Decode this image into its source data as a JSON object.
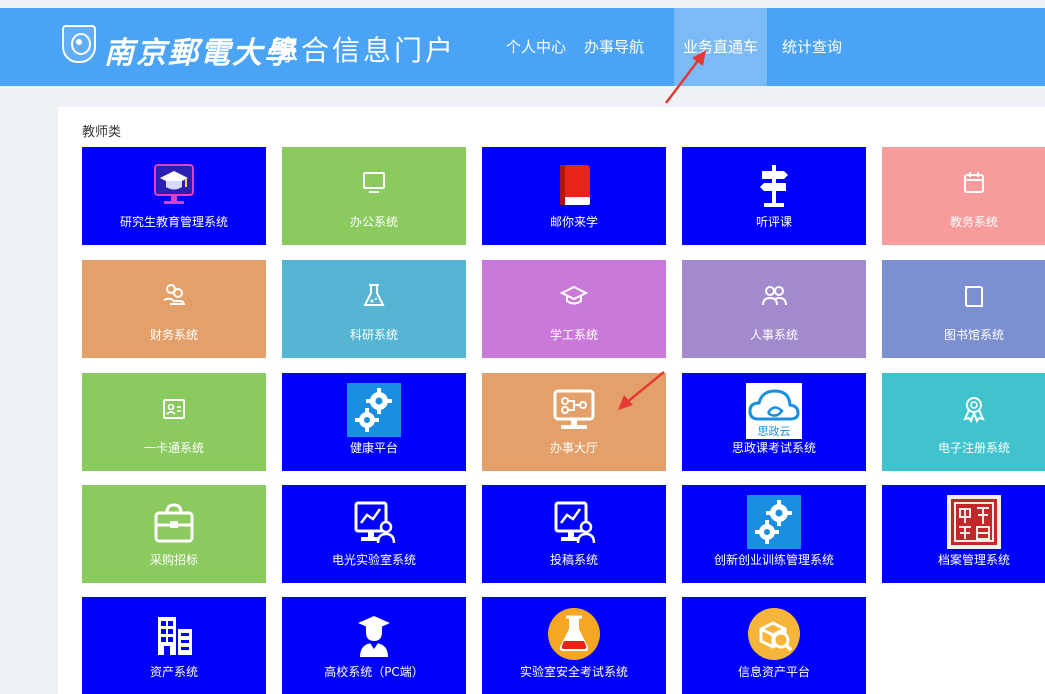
{
  "header": {
    "school_name": "南京郵電大學",
    "portal_name": "综合信息门户",
    "nav": [
      {
        "label": "个人中心",
        "active": false
      },
      {
        "label": "办事导航",
        "active": false
      },
      {
        "label": "业务直通车",
        "active": true
      },
      {
        "label": "统计查询",
        "active": false
      }
    ]
  },
  "section": {
    "title": "教师类"
  },
  "tiles": [
    {
      "label": "研究生教育管理系统",
      "icon": "graduation-monitor-icon",
      "color": "#0000fd"
    },
    {
      "label": "办公系统",
      "icon": "monitor-icon",
      "color": "#8bca5e"
    },
    {
      "label": "邮你来学",
      "icon": "red-book-icon",
      "color": "#0000fd"
    },
    {
      "label": "听评课",
      "icon": "signpost-icon",
      "color": "#0000fd"
    },
    {
      "label": "教务系统",
      "icon": "calendar-icon",
      "color": "#f69c9c"
    },
    {
      "label": "财务系统",
      "icon": "coins-hand-icon",
      "color": "#e4a06a"
    },
    {
      "label": "科研系统",
      "icon": "flask-icon",
      "color": "#55b5d2"
    },
    {
      "label": "学工系统",
      "icon": "grad-cap-icon",
      "color": "#c97ad9"
    },
    {
      "label": "人事系统",
      "icon": "people-icon",
      "color": "#a28bcc"
    },
    {
      "label": "图书馆系统",
      "icon": "book-icon",
      "color": "#7b8fd1"
    },
    {
      "label": "一卡通系统",
      "icon": "id-card-icon",
      "color": "#8bca5e"
    },
    {
      "label": "健康平台",
      "icon": "gears-icon",
      "color": "#0000fd"
    },
    {
      "label": "办事大厅",
      "icon": "network-monitor-icon",
      "color": "#e4a06a"
    },
    {
      "label": "思政课考试系统",
      "icon": "cloud-logo-icon",
      "icon_text": "思政云",
      "color": "#0000fd"
    },
    {
      "label": "电子注册系统",
      "icon": "award-ribbon-icon",
      "color": "#40c3cc"
    },
    {
      "label": "采购招标",
      "icon": "briefcase-icon",
      "color": "#8bca5e"
    },
    {
      "label": "电光实验室系统",
      "icon": "chart-user-icon",
      "color": "#0000fd"
    },
    {
      "label": "投稿系统",
      "icon": "chart-user-icon",
      "color": "#0000fd"
    },
    {
      "label": "创新创业训练管理系统",
      "icon": "gears-icon",
      "color": "#0000fd"
    },
    {
      "label": "档案管理系统",
      "icon": "seal-stamp-icon",
      "color": "#0000fd"
    },
    {
      "label": "资产系统",
      "icon": "building-icon",
      "color": "#0000fd"
    },
    {
      "label": "高校系统（PC端）",
      "icon": "graduate-user-icon",
      "color": "#0000fd"
    },
    {
      "label": "实验室安全考试系统",
      "icon": "lab-flask-circle-icon",
      "color": "#0000fd"
    },
    {
      "label": "信息资产平台",
      "icon": "cube-search-icon",
      "color": "#0000fd"
    }
  ]
}
